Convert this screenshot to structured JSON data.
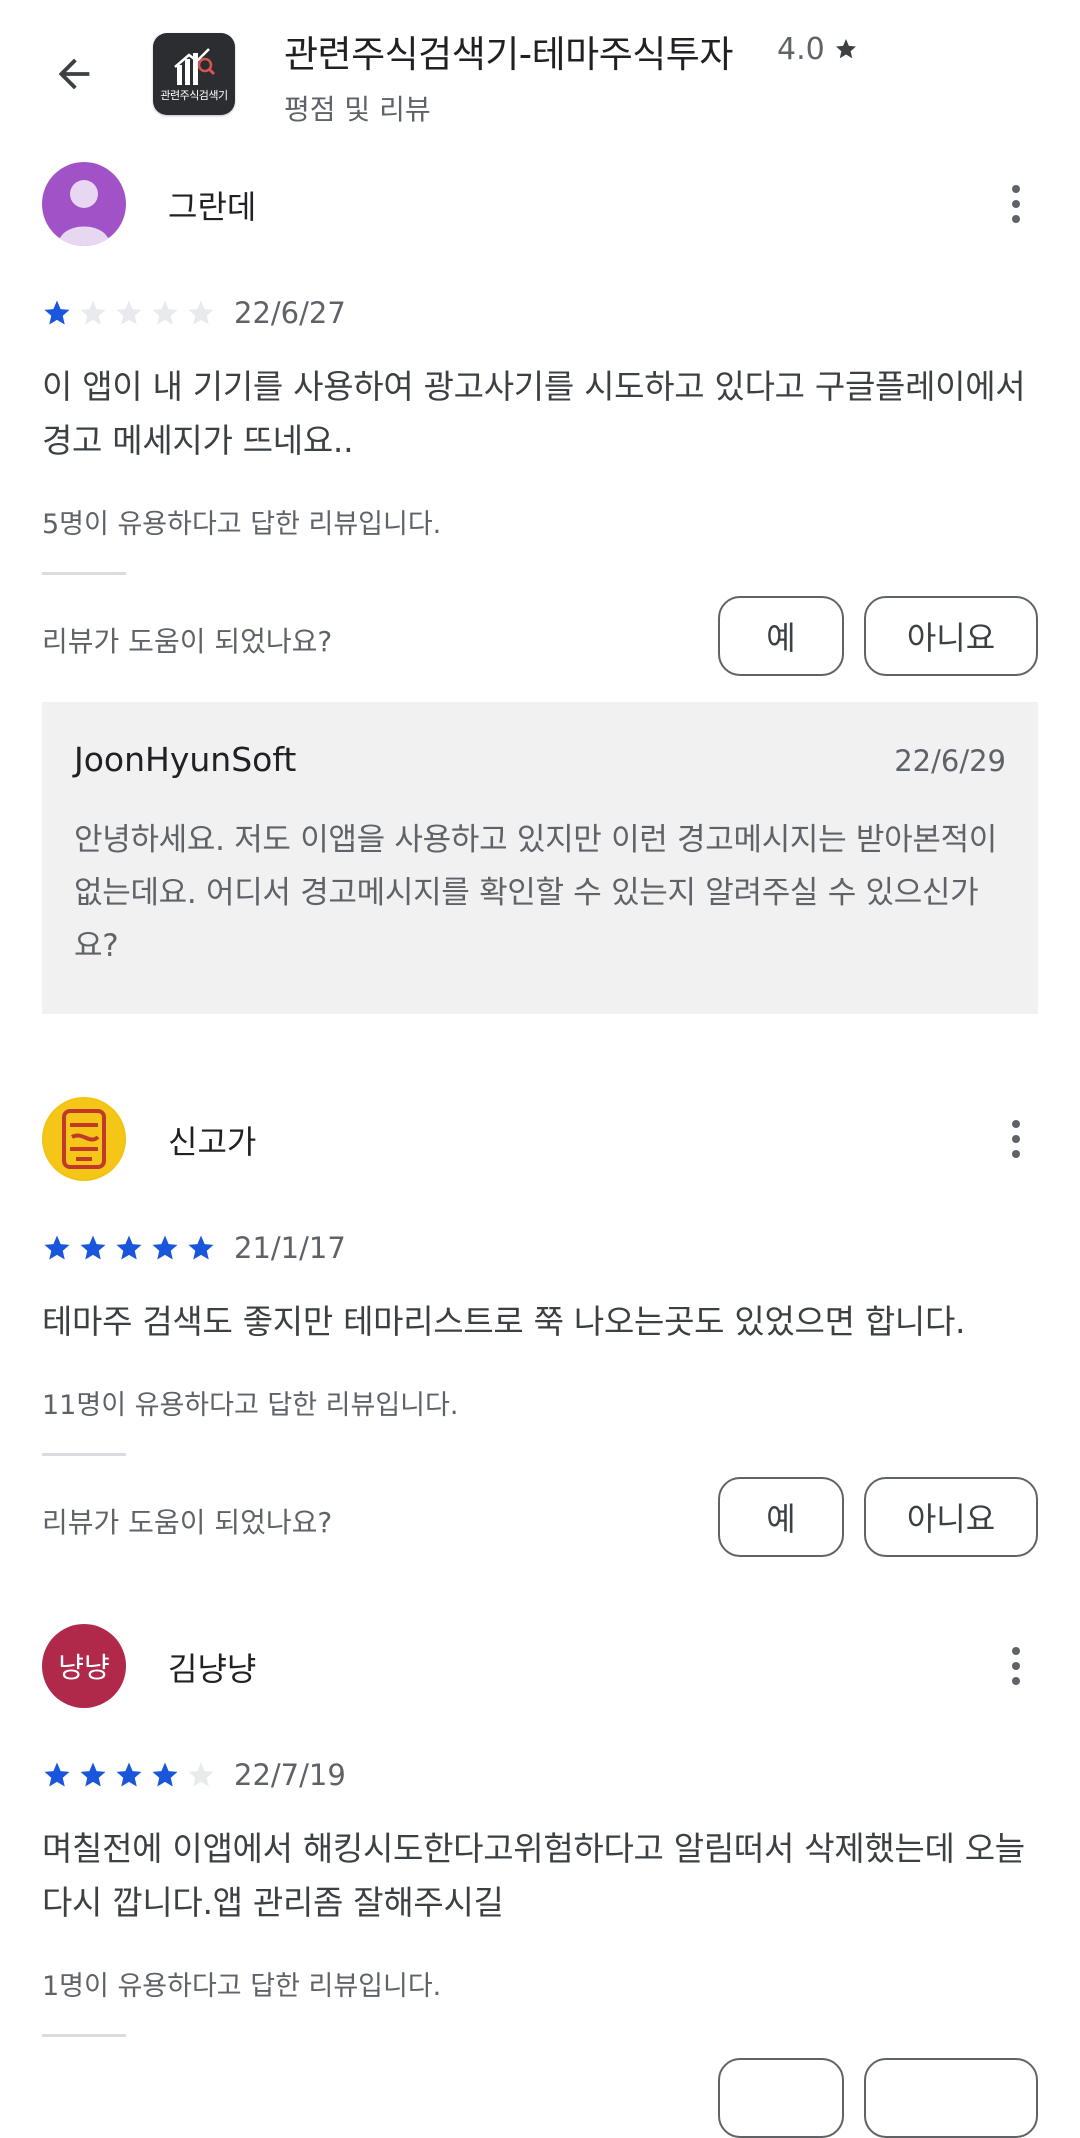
{
  "header": {
    "app_title": "관련주식검색기-테마주식투자",
    "app_rating": "4.0",
    "app_icon_text": "관련주식검색기",
    "subtitle": "평점 및 리뷰"
  },
  "colors": {
    "star_filled": "#1a56db",
    "star_empty": "#e8eaed",
    "reply_bg": "#f1f1f1"
  },
  "reviews": [
    {
      "author": "그란데",
      "avatar": "person-silhouette",
      "rating": 1,
      "date": "22/6/27",
      "text": "이 앱이 내 기기를 사용하여 광고사기를 시도하고 있다고 구글플레이에서 경고 메세지가 뜨네요..",
      "helpful": "5명이 유용하다고 답한 리뷰입니다.",
      "helpful_question": "리뷰가 도움이 되었나요?",
      "yes_label": "예",
      "no_label": "아니요",
      "reply": {
        "author": "JoonHyunSoft",
        "date": "22/6/29",
        "text": "안녕하세요. 저도 이앱을 사용하고 있지만 이런 경고메시지는 받아본적이 없는데요. 어디서 경고메시지를 확인할 수 있는지 알려주실 수 있으신가요?"
      }
    },
    {
      "author": "신고가",
      "avatar": "seal-logo",
      "rating": 5,
      "date": "21/1/17",
      "text": "테마주 검색도 좋지만 테마리스트로 쭉 나오는곳도 있었으면 합니다.",
      "helpful": "11명이 유용하다고 답한 리뷰입니다.",
      "helpful_question": "리뷰가 도움이 되었나요?",
      "yes_label": "예",
      "no_label": "아니요"
    },
    {
      "author": "김냥냥",
      "avatar_text": "냥냥",
      "rating": 4,
      "date": "22/7/19",
      "text": "며칠전에 이앱에서 해킹시도한다고위험하다고 알림떠서 삭제했는데 오늘 다시 깝니다.앱 관리좀 잘해주시길",
      "helpful": "1명이 유용하다고 답한 리뷰입니다."
    }
  ]
}
